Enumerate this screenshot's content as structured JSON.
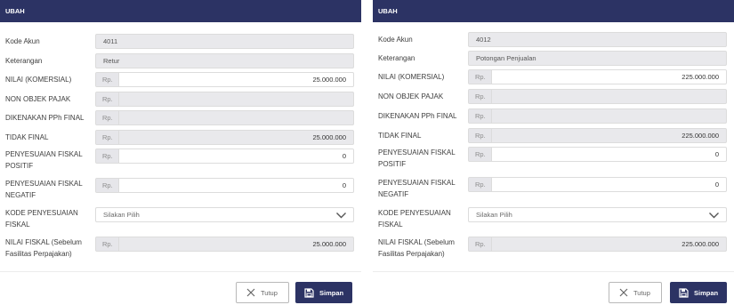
{
  "forms": [
    {
      "title": "UBAH",
      "kode_akun": {
        "label": "Kode Akun",
        "value": "4011"
      },
      "keterangan": {
        "label": "Keterangan",
        "value": "Retur"
      },
      "currency_prefix": "Rp.",
      "nilai_komersial": {
        "label": "NILAI (KOMERSIAL)",
        "value": "25.000.000"
      },
      "non_objek_pajak": {
        "label": "NON OBJEK PAJAK",
        "value": ""
      },
      "pph_final": {
        "label": "DIKENAKAN PPh FINAL",
        "value": ""
      },
      "tidak_final": {
        "label": "TIDAK FINAL",
        "value": "25.000.000"
      },
      "fiskal_positif": {
        "label_1": "PENYESUAIAN FISKAL",
        "label_2": "POSITIF",
        "value": "0"
      },
      "fiskal_negatif": {
        "label_1": "PENYESUAIAN FISKAL",
        "label_2": "NEGATIF",
        "value": "0"
      },
      "kode_penyesuaian": {
        "label_1": "KODE PENYESUAIAN",
        "label_2": "FISKAL",
        "placeholder": "Silakan Pilih"
      },
      "nilai_fiskal": {
        "label_1": "NILAI FISKAL (Sebelum",
        "label_2": "Fasilitas Perpajakan)",
        "value": "25.000.000"
      },
      "close_label": "Tutup",
      "save_label": "Simpan"
    },
    {
      "title": "UBAH",
      "kode_akun": {
        "label": "Kode Akun",
        "value": "4012"
      },
      "keterangan": {
        "label": "Keterangan",
        "value": "Potongan Penjualan"
      },
      "currency_prefix": "Rp.",
      "nilai_komersial": {
        "label": "NILAI (KOMERSIAL)",
        "value": "225.000.000"
      },
      "non_objek_pajak": {
        "label": "NON OBJEK PAJAK",
        "value": ""
      },
      "pph_final": {
        "label": "DIKENAKAN PPh FINAL",
        "value": ""
      },
      "tidak_final": {
        "label": "TIDAK FINAL",
        "value": "225.000.000"
      },
      "fiskal_positif": {
        "label_1": "PENYESUAIAN FISKAL",
        "label_2": "POSITIF",
        "value": "0"
      },
      "fiskal_negatif": {
        "label_1": "PENYESUAIAN FISKAL",
        "label_2": "NEGATIF",
        "value": "0"
      },
      "kode_penyesuaian": {
        "label_1": "KODE PENYESUAIAN",
        "label_2": "FISKAL",
        "placeholder": "Silakan Pilih"
      },
      "nilai_fiskal": {
        "label_1": "NILAI FISKAL (Sebelum",
        "label_2": "Fasilitas Perpajakan)",
        "value": "225.000.000"
      },
      "close_label": "Tutup",
      "save_label": "Simpan"
    }
  ],
  "colors": {
    "header": "#2c3364",
    "field_disabled": "#e9e9ec",
    "field_border": "#dcdcdc"
  },
  "icons": {
    "select": "chevron-down-icon",
    "close": "close-x-icon",
    "save": "save-floppy-icon"
  }
}
